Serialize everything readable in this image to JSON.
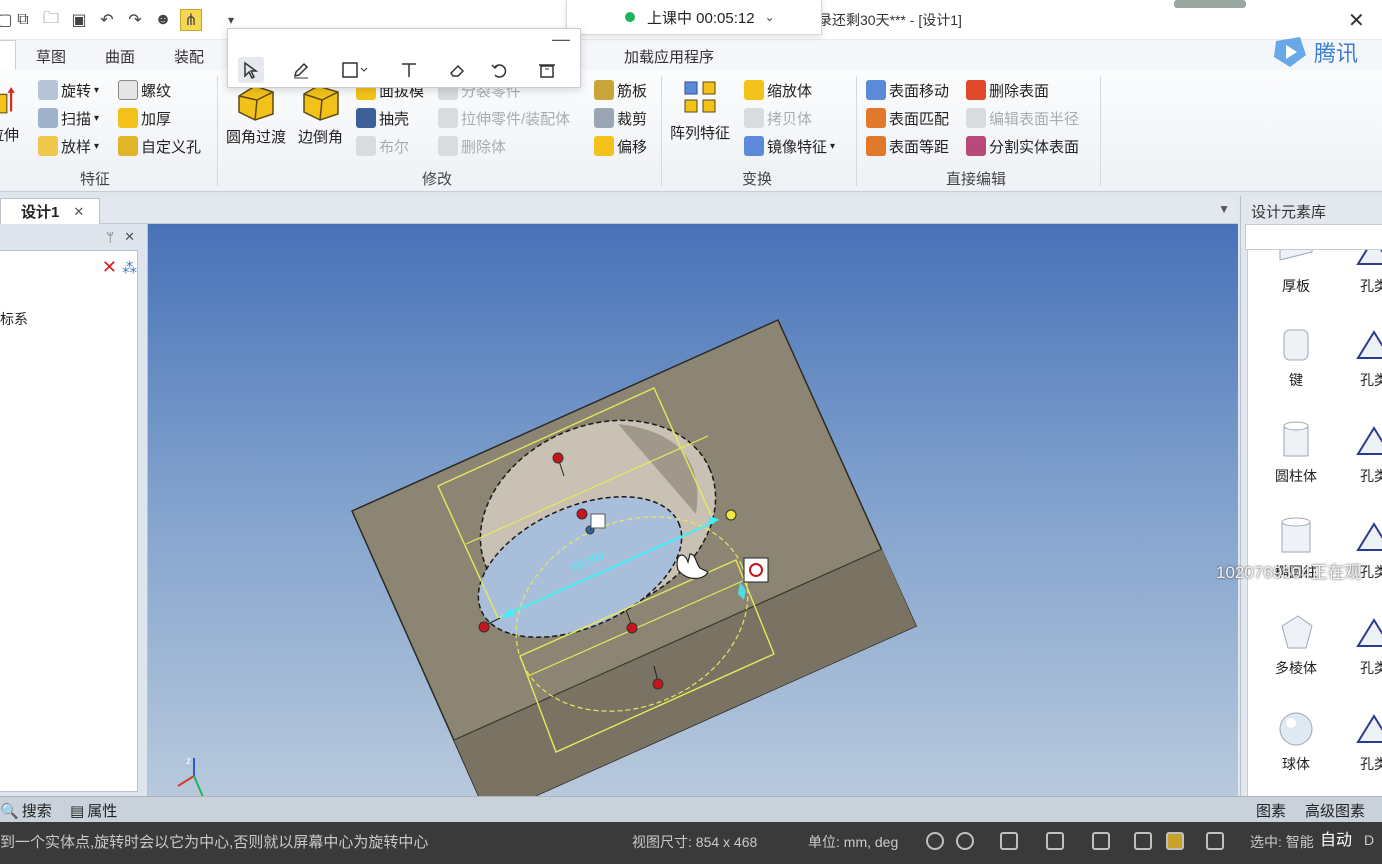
{
  "window": {
    "title": "录还剩30天*** - [设计1]"
  },
  "class_timer": {
    "label": "上课中 00:05:12"
  },
  "ribbon_tabs": [
    "草图",
    "曲面",
    "装配",
    "加载应用程序"
  ],
  "ribbon": {
    "groups": {
      "feature": {
        "label": "特征",
        "big_button": "拉伸",
        "buttons": [
          "旋转",
          "螺纹",
          "扫描",
          "加厚",
          "放样",
          "自定义孔"
        ]
      },
      "modify": {
        "label": "修改",
        "big_buttons": [
          "圆角过渡",
          "边倒角"
        ],
        "buttons": [
          "面拔模",
          "分裂零件",
          "抽壳",
          "拉伸零件/装配体",
          "布尔",
          "删除体",
          "筋板",
          "裁剪",
          "偏移"
        ]
      },
      "transform": {
        "label": "变换",
        "big_button": "阵列特征",
        "buttons": [
          "缩放体",
          "拷贝体",
          "镜像特征"
        ]
      },
      "direct_edit": {
        "label": "直接编辑",
        "buttons": [
          "表面移动",
          "删除表面",
          "表面匹配",
          "编辑表面半径",
          "表面等距",
          "分割实体表面"
        ]
      }
    }
  },
  "document_tab": {
    "label": "设计1"
  },
  "left_panel": {
    "tree_item": "标系",
    "bottom_tabs": [
      "搜索",
      "属性"
    ]
  },
  "viewport": {
    "dimension_value": "50.000",
    "axis_label": "z"
  },
  "library": {
    "title": "设计元素库",
    "items_col1": [
      "厚板",
      "键",
      "圆柱体",
      "椭圆柱",
      "多棱体",
      "球体"
    ],
    "items_col2": [
      "孔类",
      "孔类",
      "孔类",
      "孔类",
      "孔类",
      "孔类"
    ],
    "bottom_tabs": [
      "图素",
      "高级图素"
    ]
  },
  "overlay_text": "1020769504正在观",
  "status_bar": {
    "hint": "到一个实体点,旋转时会以它为中心,否则就以屏幕中心为旋转中心",
    "view_size": "视图尺寸: 854 x 468",
    "units": "单位: mm, deg",
    "selection": "选中: 智能",
    "auto": "自动",
    "right_code": "D"
  },
  "colors": {
    "accent": "#f3c21a",
    "viewport_top": "#4872b8",
    "viewport_bottom": "#b8c9dc",
    "highlight_cyan": "#3ff0f8",
    "selection_yellow": "#e8e85a",
    "timer_dot": "#1fb35b"
  }
}
